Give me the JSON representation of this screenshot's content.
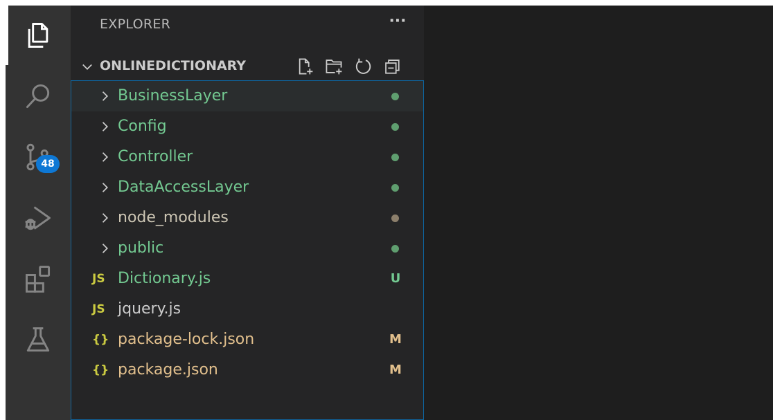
{
  "colors": {
    "git_added": "#73c991",
    "git_ignored_label": "#cdc6b4",
    "git_ignored_dot": "#8c7f6b",
    "git_modified": "#e2c08d",
    "file_default": "#cccccc",
    "js_icon": "#cbcb41",
    "json_icon": "#cbcb41",
    "accent": "#0e78d5"
  },
  "activity_bar": {
    "items": [
      {
        "icon": "files-icon"
      },
      {
        "icon": "search-icon"
      },
      {
        "icon": "source-control-icon",
        "badge": "48"
      },
      {
        "icon": "run-debug-icon"
      },
      {
        "icon": "extensions-icon"
      },
      {
        "icon": "testing-flask-icon"
      }
    ]
  },
  "sidebar": {
    "title": "EXPLORER",
    "more": "···",
    "section": {
      "title": "ONLINEDICTIONARY",
      "actions": [
        "new-file-icon",
        "new-folder-icon",
        "refresh-icon",
        "collapse-all-icon"
      ]
    },
    "tree": [
      {
        "type": "folder",
        "label": "BusinessLayer",
        "decoration": "dot",
        "color": "#73c991"
      },
      {
        "type": "folder",
        "label": "Config",
        "decoration": "dot",
        "color": "#73c991"
      },
      {
        "type": "folder",
        "label": "Controller",
        "decoration": "dot",
        "color": "#73c991"
      },
      {
        "type": "folder",
        "label": "DataAccessLayer",
        "decoration": "dot",
        "color": "#73c991"
      },
      {
        "type": "folder",
        "label": "node_modules",
        "decoration": "dot",
        "color": "#cdc6b4"
      },
      {
        "type": "folder",
        "label": "public",
        "decoration": "dot",
        "color": "#73c991"
      },
      {
        "type": "js",
        "icon_text": "JS",
        "label": "Dictionary.js",
        "decoration": "U",
        "color": "#73c991"
      },
      {
        "type": "js",
        "icon_text": "JS",
        "label": "jquery.js",
        "decoration": "",
        "color": "#cccccc"
      },
      {
        "type": "json",
        "icon_text": "{}",
        "label": "package-lock.json",
        "decoration": "M",
        "color": "#e2c08d"
      },
      {
        "type": "json",
        "icon_text": "{}",
        "label": "package.json",
        "decoration": "M",
        "color": "#e2c08d"
      }
    ]
  }
}
